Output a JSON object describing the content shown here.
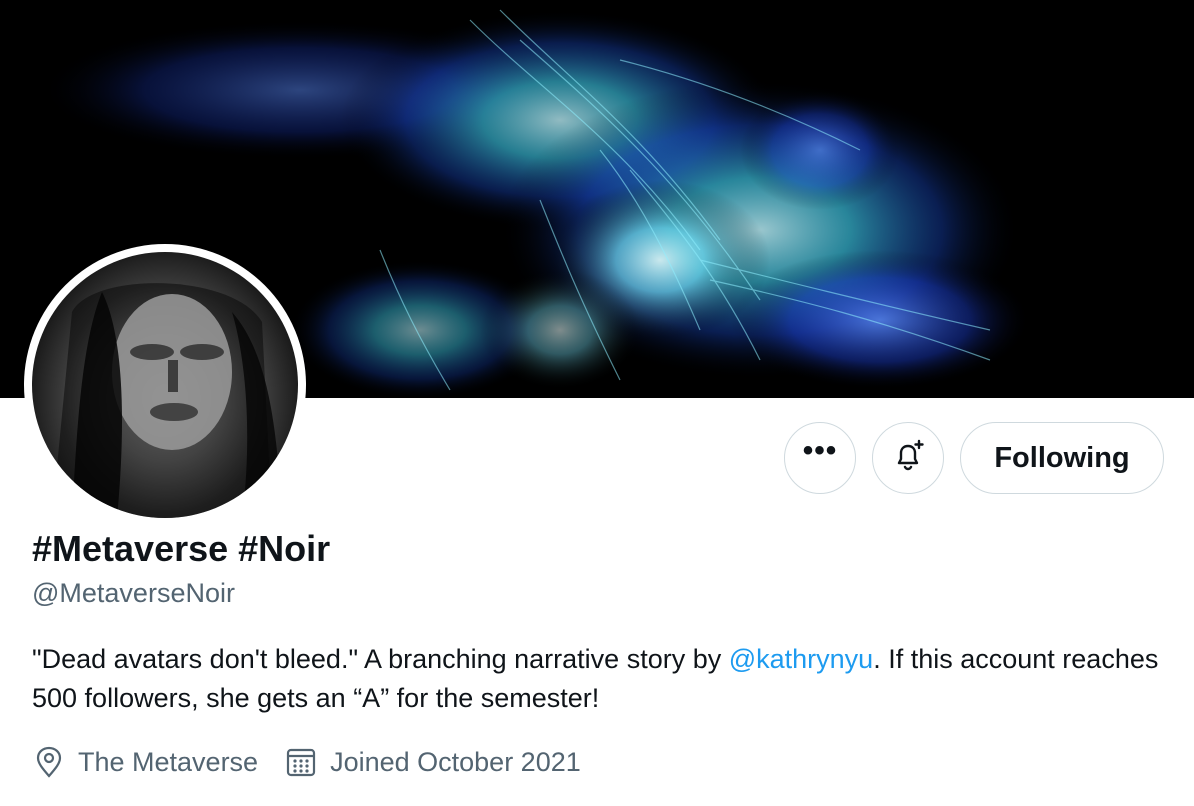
{
  "profile": {
    "display_name": "#Metaverse #Noir",
    "handle": "@MetaverseNoir",
    "bio": {
      "part1": "\"Dead avatars don't bleed.\" A branching narrative story by ",
      "mention": "@kathrynyu",
      "part2": ". If this account reaches 500 followers, she gets an “A” for the semester!"
    },
    "location": "The Metaverse",
    "joined": "Joined October 2021"
  },
  "actions": {
    "more_label": "•••",
    "following_label": "Following"
  },
  "icons": {
    "more": "more-horizontal-icon",
    "notify": "bell-plus-icon",
    "location": "location-pin-icon",
    "calendar": "calendar-icon"
  },
  "colors": {
    "link": "#1d9bf0",
    "secondary_text": "#536471",
    "border": "#cfd9de",
    "primary_text": "#0f1419"
  }
}
